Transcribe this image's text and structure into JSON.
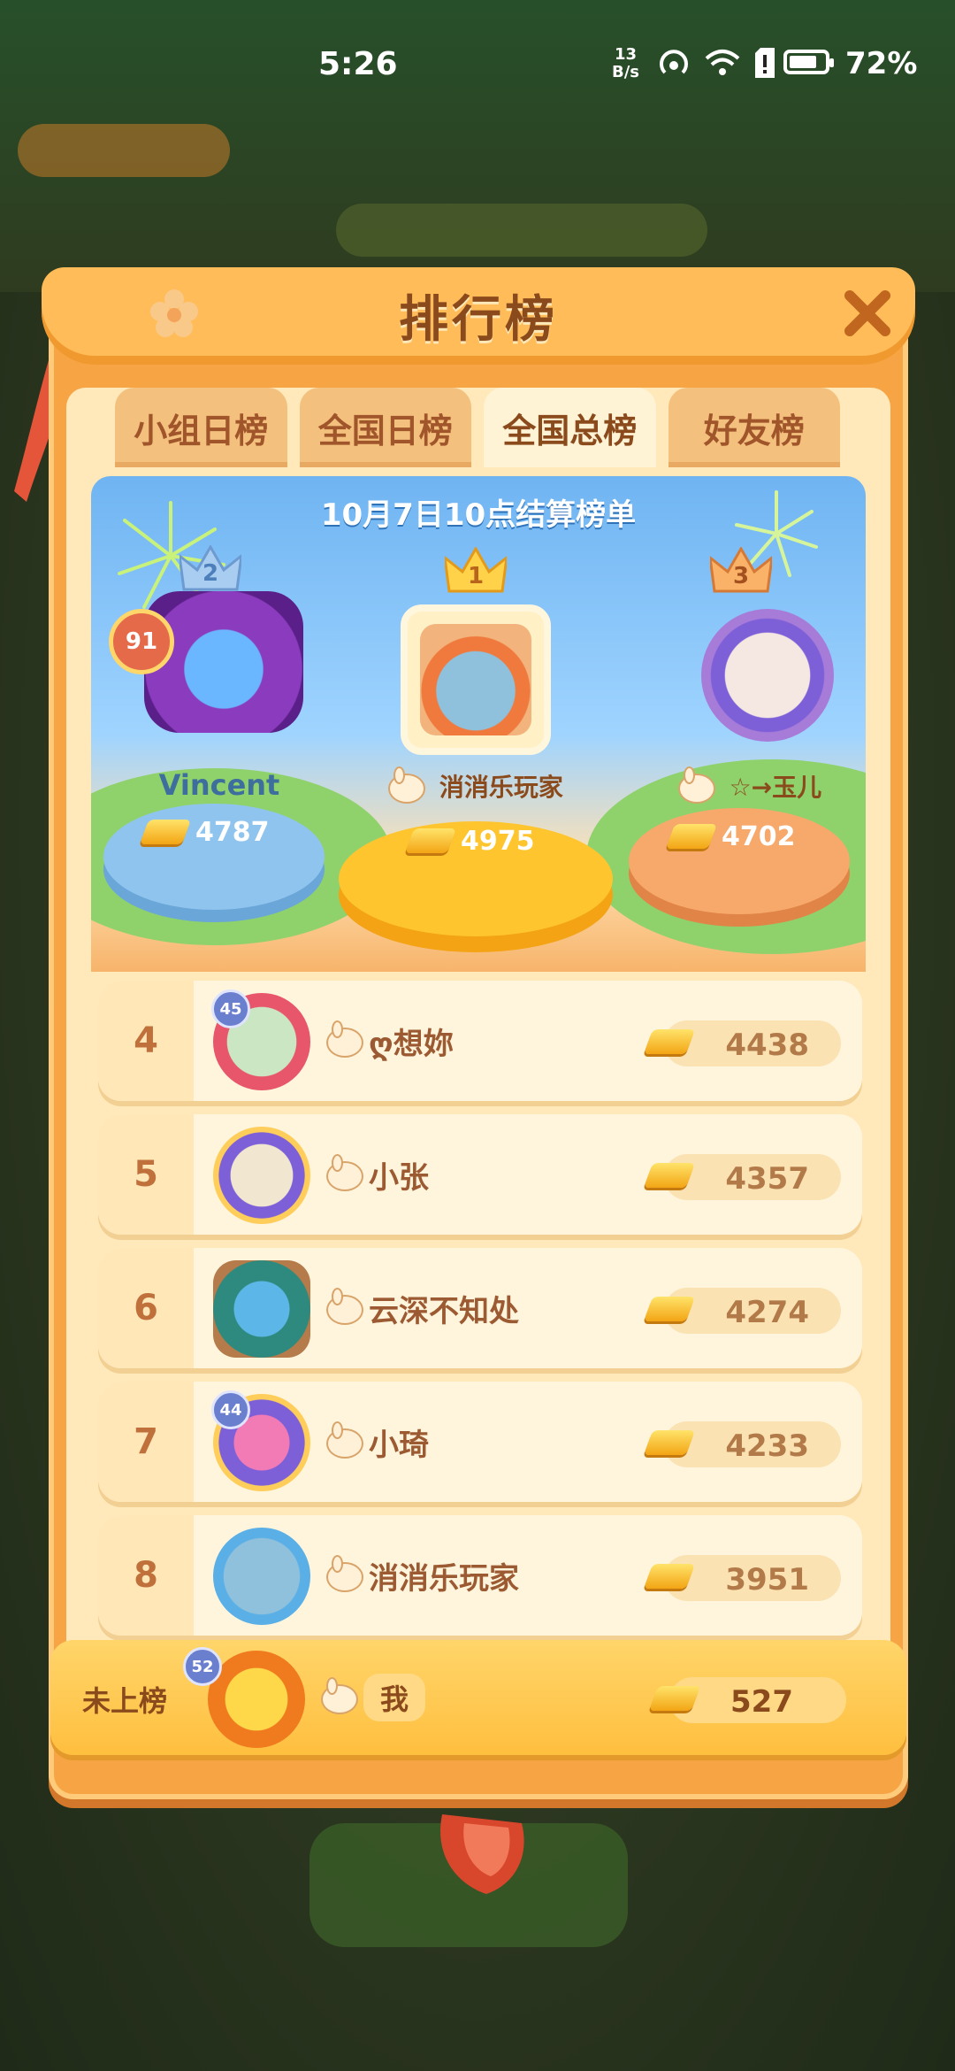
{
  "status_bar": {
    "time": "5:26",
    "net_speed_top": "13",
    "net_speed_unit": "B/s",
    "battery_percent": "72%"
  },
  "dialog": {
    "title": "排行榜",
    "tabs": [
      "小组日榜",
      "全国日榜",
      "全国总榜",
      "好友榜"
    ],
    "active_tab": "全国总榜",
    "settlement_text": "10月7日10点结算榜单"
  },
  "podium": {
    "first": {
      "rank": "1",
      "name": "消消乐玩家",
      "score": "4975"
    },
    "second": {
      "rank": "2",
      "name": "Vincent",
      "score": "4787",
      "level": "91"
    },
    "third": {
      "rank": "3",
      "name": "☆→玉儿",
      "score": "4702"
    }
  },
  "ranking_list": [
    {
      "rank": "4",
      "name": "ღ想妳",
      "score": "4438",
      "level": "45"
    },
    {
      "rank": "5",
      "name": "小张",
      "score": "4357",
      "level": ""
    },
    {
      "rank": "6",
      "name": "云深不知处",
      "score": "4274",
      "level": ""
    },
    {
      "rank": "7",
      "name": "小琦",
      "score": "4233",
      "level": "44"
    },
    {
      "rank": "8",
      "name": "消消乐玩家",
      "score": "3951",
      "level": ""
    }
  ],
  "my_entry": {
    "status": "未上榜",
    "name": "我",
    "score": "527",
    "level": "52"
  },
  "icons": {
    "close": "close-icon",
    "crown": "crown-icon",
    "gold": "gold-bar-icon",
    "bunny": "bunny-badge-icon"
  },
  "colors": {
    "frame": "#f7a444",
    "panel": "#ffe8b9",
    "title_text": "#8b4a1c",
    "sky": "#6fb4f2"
  }
}
